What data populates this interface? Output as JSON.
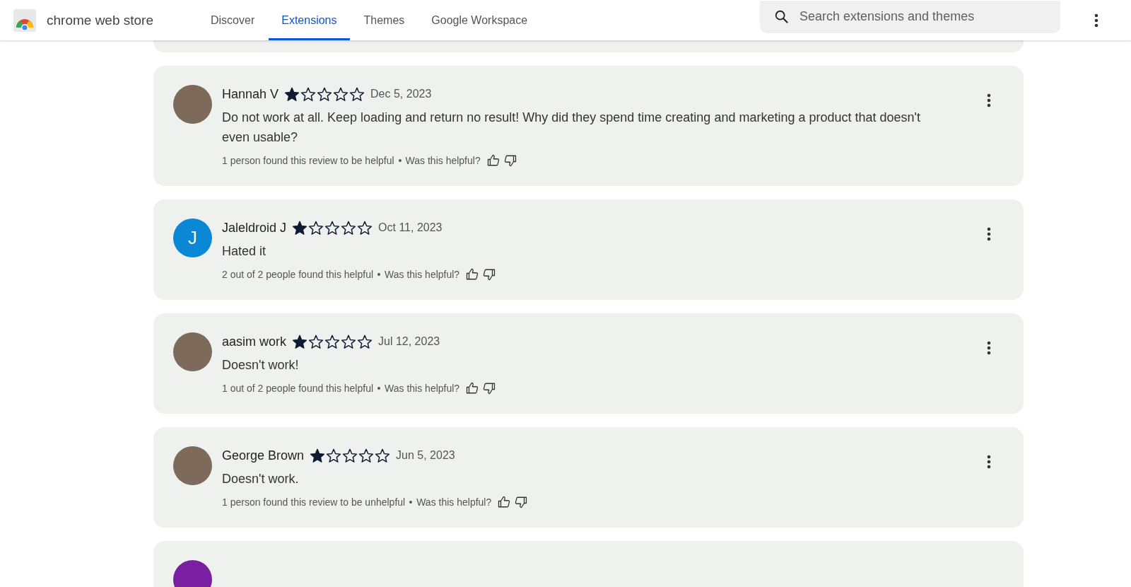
{
  "header": {
    "logo_text": "chrome web store",
    "nav": [
      {
        "label": "Discover",
        "selected": false
      },
      {
        "label": "Extensions",
        "selected": true
      },
      {
        "label": "Themes",
        "selected": false
      },
      {
        "label": "Google Workspace",
        "selected": false
      }
    ],
    "search": {
      "placeholder": "Search extensions and themes"
    }
  },
  "reviews": [
    {
      "author": "Hannah V",
      "stars": 1,
      "date": "Dec 5, 2023",
      "text": "Do not work at all. Keep loading and return no result! Why did they spend time creating and marketing a product that doesn't even usable?",
      "helpful": "1 person found this review to be helpful",
      "prompt": "Was this helpful?",
      "avatar": {
        "kind": "photo"
      }
    },
    {
      "author": "Jaleldroid J",
      "stars": 1,
      "date": "Oct 11, 2023",
      "text": "Hated it",
      "helpful": "2 out of 2 people found this helpful",
      "prompt": "Was this helpful?",
      "avatar": {
        "kind": "letter",
        "letter": "J",
        "color": "#0a88d6"
      }
    },
    {
      "author": "aasim work",
      "stars": 1,
      "date": "Jul 12, 2023",
      "text": "Doesn't work!",
      "helpful": "1 out of 2 people found this helpful",
      "prompt": "Was this helpful?",
      "avatar": {
        "kind": "photo"
      }
    },
    {
      "author": "George Brown",
      "stars": 1,
      "date": "Jun 5, 2023",
      "text": "Doesn't work.",
      "helpful": "1 person found this review to be unhelpful",
      "prompt": "Was this helpful?",
      "avatar": {
        "kind": "photo"
      }
    }
  ],
  "more_below": {
    "color": "#7b1fa2"
  }
}
